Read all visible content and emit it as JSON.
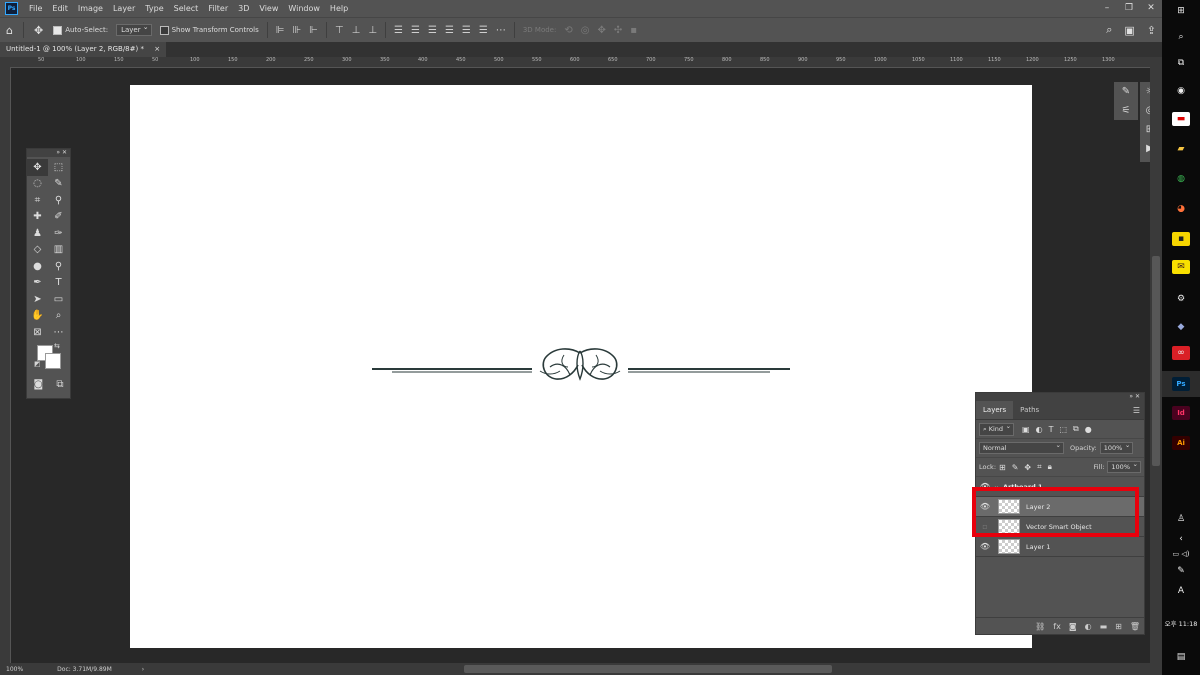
{
  "app": {
    "logo": "Ps",
    "menu": [
      "File",
      "Edit",
      "Image",
      "Layer",
      "Type",
      "Select",
      "Filter",
      "3D",
      "View",
      "Window",
      "Help"
    ]
  },
  "options_bar": {
    "auto_select_label": "Auto-Select:",
    "auto_select_value": "Layer",
    "show_transform_label": "Show Transform Controls",
    "mode_3d_label": "3D Mode:"
  },
  "document": {
    "tab_title": "Untitled-1 @ 100% (Layer 2, RGB/8#) *",
    "close_glyph": "×"
  },
  "ruler": {
    "h_ticks": [
      "50",
      "100",
      "150",
      "50",
      "100",
      "150",
      "200",
      "250",
      "300",
      "350",
      "400",
      "450",
      "500",
      "550",
      "600",
      "650",
      "700",
      "750",
      "800",
      "850",
      "900",
      "950",
      "1000",
      "1050",
      "1100",
      "1150",
      "1200",
      "1250",
      "1300"
    ]
  },
  "layers_panel": {
    "tabs": [
      "Layers",
      "Paths"
    ],
    "filter_kind": "Kind",
    "blend_mode": "Normal",
    "opacity_label": "Opacity:",
    "opacity_value": "100%",
    "lock_label": "Lock:",
    "fill_label": "Fill:",
    "fill_value": "100%",
    "artboard_name": "Artboard 1",
    "layers": [
      {
        "name": "Layer 2",
        "visible": true,
        "selected": true
      },
      {
        "name": "Vector Smart Object",
        "visible": false,
        "selected": false
      },
      {
        "name": "Layer 1",
        "visible": true,
        "selected": false
      }
    ]
  },
  "status": {
    "zoom": "100%",
    "doc_info": "Doc: 3.71M/9.89M"
  },
  "taskbar": {
    "time": "오후 11:18",
    "ime": "A",
    "apps": [
      "Id",
      "Ai",
      "Ps"
    ]
  },
  "colors": {
    "panel_bg": "#535353",
    "workspace_bg": "#282828",
    "highlight_red": "#e8000c",
    "ps_blue": "#31a8ff"
  }
}
